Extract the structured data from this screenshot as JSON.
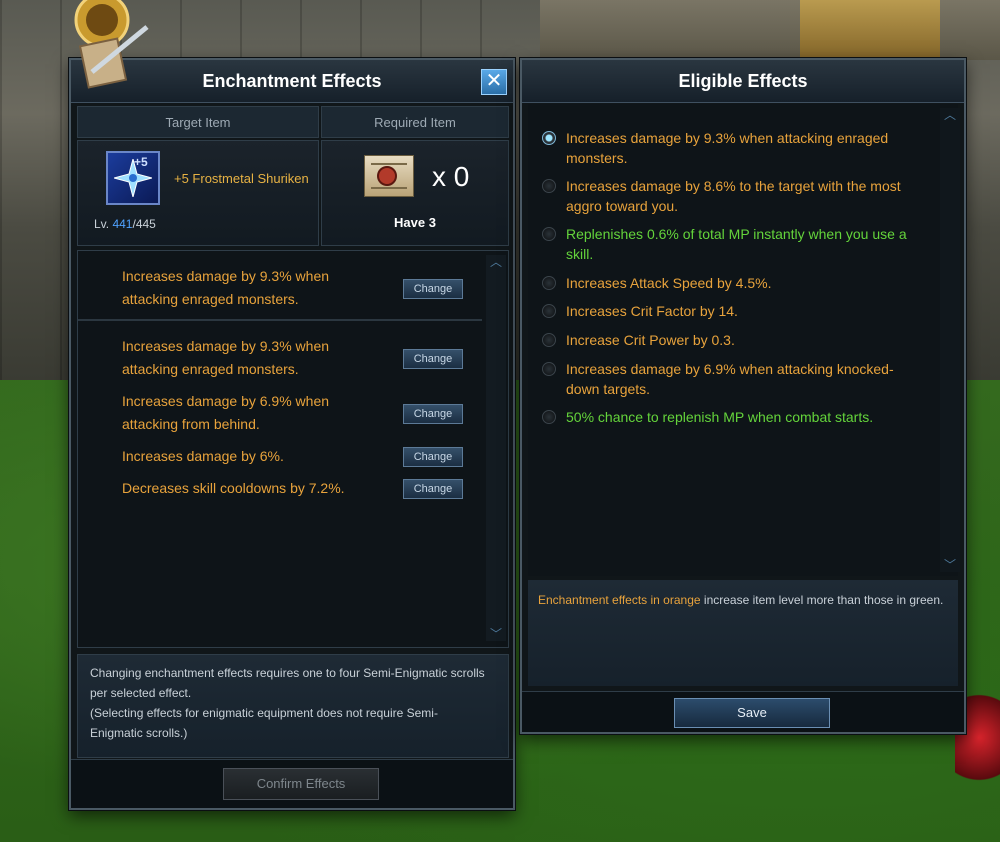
{
  "left_panel": {
    "title": "Enchantment Effects",
    "close_label": "✕",
    "target_item_header": "Target Item",
    "required_item_header": "Required Item",
    "target_item": {
      "plus": "+5",
      "name": "+5 Frostmetal Shuriken",
      "level_prefix": "Lv. ",
      "level_current": "441",
      "level_max": "/445"
    },
    "required_item": {
      "count": "x 0",
      "have": "Have 3"
    },
    "effects": [
      {
        "text": "Increases damage by 9.3% when attacking enraged monsters.",
        "button": "Change"
      },
      {
        "text": "Increases damage by 9.3% when attacking enraged monsters.",
        "button": "Change"
      },
      {
        "text": "Increases damage by 6.9% when attacking from behind.",
        "button": "Change"
      },
      {
        "text": "Increases damage by 6%.",
        "button": "Change"
      },
      {
        "text": "Decreases skill cooldowns by 7.2%.",
        "button": "Change"
      }
    ],
    "note_line1": "Changing enchantment effects requires one to four Semi-Enigmatic scrolls per selected effect.",
    "note_line2": "(Selecting effects for enigmatic equipment does not require Semi-Enigmatic scrolls.)",
    "confirm_label": "Confirm Effects"
  },
  "right_panel": {
    "title": "Eligible Effects",
    "options": [
      {
        "text": "Increases damage by 9.3% when attacking enraged monsters.",
        "color": "orange",
        "selected": true
      },
      {
        "text": "Increases damage by 8.6% to the target with the most aggro toward you.",
        "color": "orange",
        "selected": false
      },
      {
        "text": "Replenishes 0.6% of total MP instantly when you use a skill.",
        "color": "green",
        "selected": false
      },
      {
        "text": "Increases Attack Speed by 4.5%.",
        "color": "orange",
        "selected": false
      },
      {
        "text": "Increases Crit Factor by 14.",
        "color": "orange",
        "selected": false
      },
      {
        "text": "Increase Crit Power by 0.3.",
        "color": "orange",
        "selected": false
      },
      {
        "text": "Increases damage by 6.9% when attacking knocked-down targets.",
        "color": "orange",
        "selected": false
      },
      {
        "text": "50% chance to replenish MP when combat starts.",
        "color": "green",
        "selected": false
      }
    ],
    "legend_orange": "Enchantment effects in orange",
    "legend_rest": " increase item level more than those in green.",
    "save_label": "Save"
  },
  "scroll_up": "︿",
  "scroll_down": "﹀",
  "colors": {
    "orange": "#e8a33c",
    "green": "#64d43b",
    "accent": "#4fa2ff"
  }
}
